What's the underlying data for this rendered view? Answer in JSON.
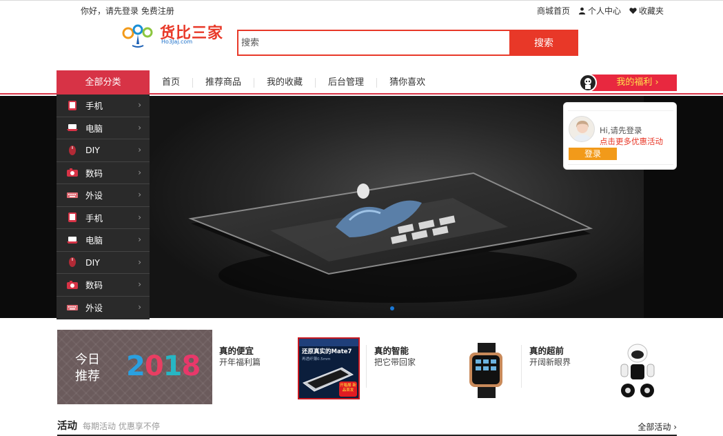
{
  "topbar": {
    "greeting": "你好，请先登录",
    "register": "免费注册",
    "links": [
      {
        "label": "商城首页",
        "icon": ""
      },
      {
        "label": "个人中心",
        "icon": "user-icon"
      },
      {
        "label": "收藏夹",
        "icon": "heart-icon"
      }
    ]
  },
  "logo": {
    "text": "货比三家",
    "sub": "Ho3Jaj.com"
  },
  "search": {
    "placeholder": "搜索",
    "button": "搜索"
  },
  "nav": {
    "all_categories": "全部分类",
    "items": [
      "首页",
      "推荐商品",
      "我的收藏",
      "后台管理",
      "猜你喜欢"
    ],
    "welfare": "我的福利 ›"
  },
  "sidebar": {
    "items": [
      {
        "label": "手机",
        "icon": "tablet-icon"
      },
      {
        "label": "电脑",
        "icon": "laptop-icon"
      },
      {
        "label": "DIY",
        "icon": "mouse-icon"
      },
      {
        "label": "数码",
        "icon": "camera-icon"
      },
      {
        "label": "外设",
        "icon": "keyboard-icon"
      },
      {
        "label": "手机",
        "icon": "tablet-icon"
      },
      {
        "label": "电脑",
        "icon": "laptop-icon"
      },
      {
        "label": "DIY",
        "icon": "mouse-icon"
      },
      {
        "label": "数码",
        "icon": "camera-icon"
      },
      {
        "label": "外设",
        "icon": "keyboard-icon"
      }
    ]
  },
  "login_card": {
    "hi": "Hi,请先登录",
    "promo": "点击更多优惠活动",
    "button": "登录"
  },
  "promo": {
    "title": "今日推荐",
    "year": "2018"
  },
  "products": [
    {
      "title": "真的便宜",
      "subtitle": "开年福利篇"
    },
    {
      "title": "真的智能",
      "subtitle": "把它带回家"
    },
    {
      "title": "真的超前",
      "subtitle": "开阔新眼界"
    }
  ],
  "mate7": {
    "title": "还原真实的Mate7",
    "sub": "再透纤薄0.5mm",
    "badge": "开箱展 新品首发"
  },
  "activity": {
    "title": "活动",
    "subtitle": "每期活动 优惠享不停",
    "all": "全部活动 ›"
  },
  "colors": {
    "accent": "#e83828",
    "nav": "#d73346",
    "welfare": "#e8283f",
    "login_btn": "#f29a1a"
  }
}
